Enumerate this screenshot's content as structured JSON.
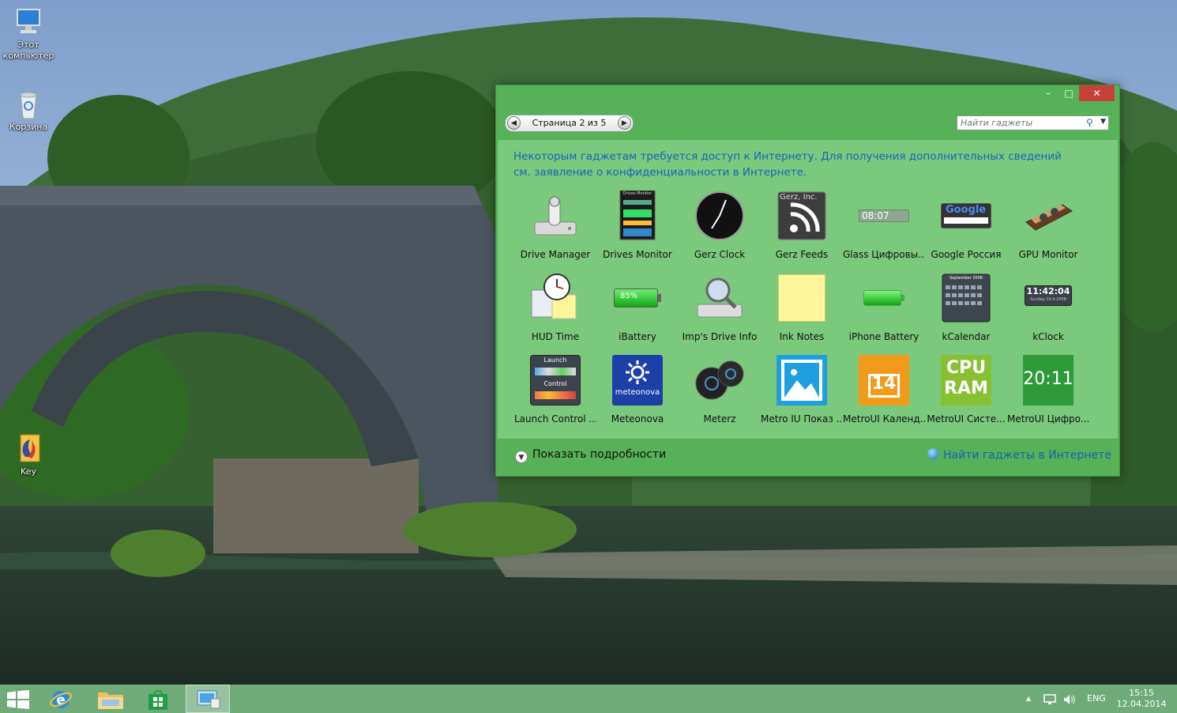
{
  "desktop": {
    "icons": [
      {
        "label": "Этот компьютер",
        "icon": "computer-icon"
      },
      {
        "label": "Корзина",
        "icon": "recycle-bin-icon"
      },
      {
        "label": "Key",
        "icon": "key-file-icon"
      }
    ]
  },
  "window": {
    "buttons": {
      "minimize": "–",
      "maximize": "□",
      "close": "✕"
    },
    "pager": {
      "text": "Страница 2 из 5",
      "prev": "◀",
      "next": "▶"
    },
    "search": {
      "placeholder": "Найти гаджеты",
      "icon": "search-icon"
    },
    "notice": "Некоторым гаджетам требуется доступ к Интернету. Для получения дополнительных сведений см. заявление о конфиденциальности в Интернете.",
    "gadgets": [
      {
        "label": "Drive Manager",
        "icon": "drive-manager-icon"
      },
      {
        "label": "Drives Monitor",
        "icon": "drives-monitor-icon",
        "text": "Drives Monitor"
      },
      {
        "label": "Gerz Clock",
        "icon": "clock-icon"
      },
      {
        "label": "Gerz Feeds",
        "icon": "rss-feed-icon",
        "text": "Gerz, Inc."
      },
      {
        "label": "Glass Цифровы...",
        "icon": "glass-digital-clock-icon",
        "text": "08:07"
      },
      {
        "label": "Google Россия",
        "icon": "google-search-icon",
        "text": "Google"
      },
      {
        "label": "GPU Monitor",
        "icon": "graphics-card-icon"
      },
      {
        "label": "HUD Time",
        "icon": "hud-time-icon"
      },
      {
        "label": "iBattery",
        "icon": "battery-icon",
        "text": "85%"
      },
      {
        "label": "Imp's Drive Info",
        "icon": "drive-info-magnifier-icon"
      },
      {
        "label": "Ink Notes",
        "icon": "sticky-note-icon"
      },
      {
        "label": "iPhone Battery",
        "icon": "phone-battery-icon"
      },
      {
        "label": "kCalendar",
        "icon": "calendar-icon",
        "text": "September 2008"
      },
      {
        "label": "kClock",
        "icon": "digital-clock-icon",
        "text": "11:42:04",
        "subtext": "Sunday 20.9.2008"
      },
      {
        "label": "Launch Control ...",
        "icon": "launch-control-icon",
        "text": "Launch",
        "subtext": "Control"
      },
      {
        "label": "Meteonova",
        "icon": "weather-sun-icon",
        "text": "meteonova"
      },
      {
        "label": "Meterz",
        "icon": "meterz-icon"
      },
      {
        "label": "Metro IU Показ ...",
        "icon": "picture-slideshow-icon"
      },
      {
        "label": "MetroUI Календ...",
        "icon": "metro-calendar-icon",
        "text": "14"
      },
      {
        "label": "MetroUI Систе...",
        "icon": "cpu-ram-meter-icon",
        "text": "CPU",
        "subtext": "RAM"
      },
      {
        "label": "MetroUI Цифро...",
        "icon": "metro-digital-clock-icon",
        "text": "20:11"
      }
    ],
    "footer": {
      "details": "Показать подробности",
      "details_icon": "chevron-down-icon",
      "online": "Найти гаджеты в Интернете",
      "online_icon": "globe-icon"
    }
  },
  "taskbar": {
    "items": [
      {
        "name": "start",
        "icon": "windows-start-icon"
      },
      {
        "name": "internet-explorer",
        "icon": "internet-explorer-icon"
      },
      {
        "name": "file-explorer",
        "icon": "folder-icon"
      },
      {
        "name": "store",
        "icon": "store-icon"
      },
      {
        "name": "gadgets",
        "icon": "gadgets-window-icon",
        "active": true
      }
    ],
    "tray": {
      "show_hidden": "▲",
      "language": "ENG",
      "time": "15:15",
      "date": "12.04.2014"
    }
  },
  "colors": {
    "window_bg": "#56b158",
    "content_bg": "#7ac97c",
    "link": "#1463b0",
    "close": "#c7403a"
  }
}
